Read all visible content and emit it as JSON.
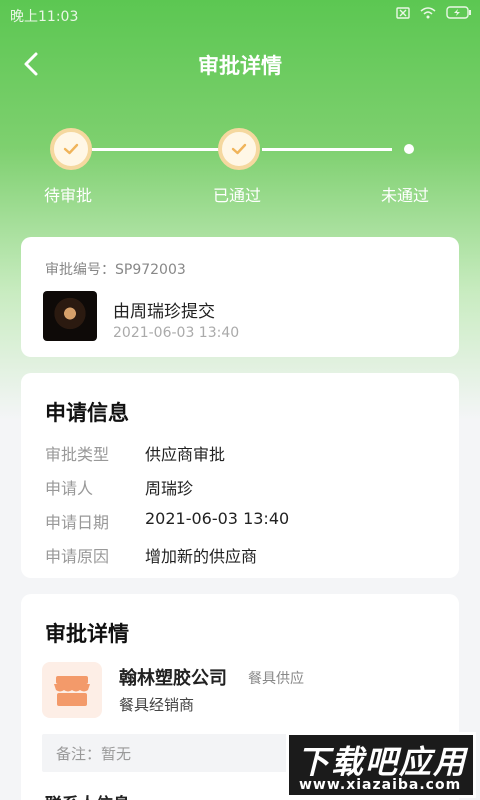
{
  "status_bar": {
    "time": "晚上11:03"
  },
  "header": {
    "title": "审批详情"
  },
  "steps": [
    {
      "label": "待审批",
      "state": "done"
    },
    {
      "label": "已通过",
      "state": "done"
    },
    {
      "label": "未通过",
      "state": "pending"
    }
  ],
  "summary": {
    "approval_no": "审批编号：SP972003",
    "submitter": "由周瑞珍提交",
    "submit_time": "2021-06-03 13:40"
  },
  "application": {
    "title": "申请信息",
    "rows": [
      {
        "label": "审批类型",
        "value": "供应商审批"
      },
      {
        "label": "申请人",
        "value": "周瑞珍"
      },
      {
        "label": "申请日期",
        "value": "2021-06-03 13:40"
      },
      {
        "label": "申请原因",
        "value": "增加新的供应商"
      }
    ]
  },
  "detail": {
    "title": "审批详情",
    "company": "翰林塑胶公司",
    "tag": "餐具供应",
    "subtitle": "餐具经销商",
    "remark": "备注：暂无",
    "contact_title": "联系人信息"
  },
  "watermark": {
    "main": "下载吧应用",
    "sub": "www.xiazaiba.com"
  },
  "colors": {
    "accent": "#5cc752",
    "check": "#f0b45a",
    "shop": "#f39a6a"
  }
}
